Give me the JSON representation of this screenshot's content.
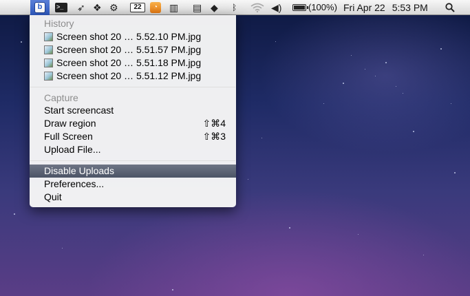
{
  "menubar": {
    "status_icons": [
      "app-b-icon",
      "terminal-icon",
      "bird-icon",
      "dropbox-icon",
      "gear-icon",
      "calendar-icon",
      "rss-icon",
      "film-icon",
      "document-icon",
      "evernote-icon",
      "bluetooth-icon",
      "wifi-icon",
      "volume-icon",
      "battery-icon"
    ],
    "calendar_day": "22",
    "battery_percent": "(100%)",
    "battery_level": 1.0,
    "clock_date": "Fri Apr 22",
    "clock_time": "5:53 PM"
  },
  "menu": {
    "history_title": "History",
    "history": [
      {
        "label": "Screen shot 20 … 5.52.10 PM.jpg"
      },
      {
        "label": "Screen shot 20 … 5.51.57 PM.jpg"
      },
      {
        "label": "Screen shot 20 … 5.51.18 PM.jpg"
      },
      {
        "label": "Screen shot 20 … 5.51.12 PM.jpg"
      }
    ],
    "capture_title": "Capture",
    "capture": [
      {
        "label": "Start screencast",
        "shortcut": ""
      },
      {
        "label": "Draw region",
        "shortcut": "⇧⌘4"
      },
      {
        "label": "Full Screen",
        "shortcut": "⇧⌘3"
      },
      {
        "label": "Upload File...",
        "shortcut": ""
      }
    ],
    "disable_uploads": "Disable Uploads",
    "preferences": "Preferences...",
    "quit": "Quit",
    "selected_item": "Disable Uploads"
  },
  "colors": {
    "menu_highlight": "#5a6275",
    "menubar_active": "#3b66cc"
  }
}
